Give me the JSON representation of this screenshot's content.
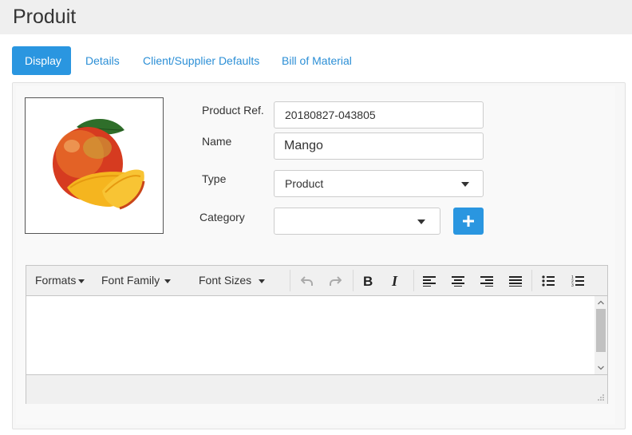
{
  "page": {
    "title": "Produit"
  },
  "tabs": [
    {
      "label": "Display",
      "active": true
    },
    {
      "label": "Details",
      "active": false
    },
    {
      "label": "Client/Supplier Defaults",
      "active": false
    },
    {
      "label": "Bill of Material",
      "active": false
    }
  ],
  "form": {
    "product_ref": {
      "label": "Product Ref.",
      "value": "20180827-043805"
    },
    "name": {
      "label": "Name",
      "value": "Mango"
    },
    "type": {
      "label": "Type",
      "value": "Product"
    },
    "category": {
      "label": "Category",
      "value": ""
    }
  },
  "editor": {
    "menus": {
      "formats": "Formats",
      "font_family": "Font Family",
      "font_sizes": "Font Sizes"
    },
    "content": ""
  },
  "colors": {
    "accent": "#2a96e0",
    "tab_text": "#2c8fd6"
  }
}
